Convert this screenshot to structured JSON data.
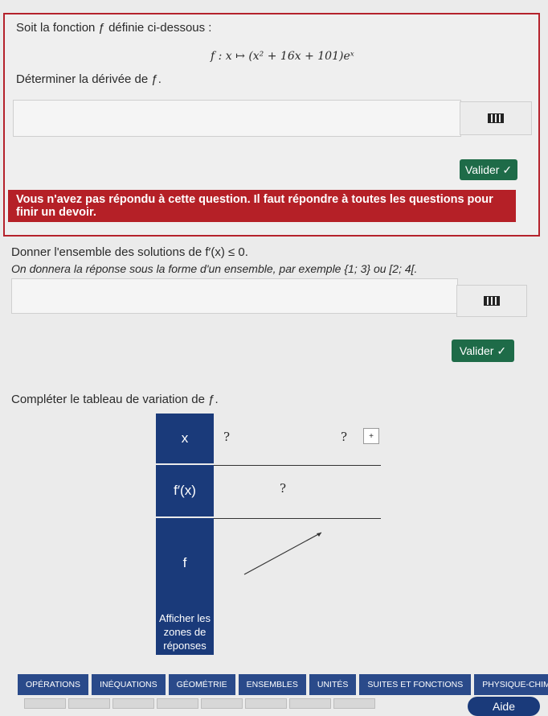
{
  "q1": {
    "intro": "Soit la fonction ƒ définie ci-dessous :",
    "formula": "f : x ↦ (x² + 16x + 101)eˣ",
    "task": "Déterminer la dérivée de ƒ.",
    "validate_label": "Valider ✓",
    "error_banner": "Vous n'avez pas répondu à cette question. Il faut répondre à toutes les questions pour finir un devoir."
  },
  "q2": {
    "task": "Donner l'ensemble des solutions de f′(x) ≤ 0.",
    "hint": "On donnera la réponse sous la forme d'un ensemble, par exemple {1; 3} ou [2; 4[.",
    "validate_label": "Valider ✓"
  },
  "q3": {
    "task": "Compléter le tableau de variation de ƒ.",
    "row_x": "x",
    "row_fprime": "f′(x)",
    "row_f": "f",
    "x_left": "?",
    "x_right": "?",
    "fprime_value": "?",
    "plus_button": "+",
    "show_answers": "Afficher les zones de réponses"
  },
  "menu": [
    "OPÉRATIONS",
    "INÉQUATIONS",
    "GÉOMÉTRIE",
    "ENSEMBLES",
    "UNITÉS",
    "SUITES ET FONCTIONS",
    "PHYSIQUE-CHIMIE"
  ],
  "help_label": "Aide",
  "colors": {
    "error_red": "#b52027",
    "validate_green": "#1e6b48",
    "table_blue": "#1a3a7a",
    "menu_blue": "#2a4a8a"
  },
  "icons": {
    "keyboard": "keyboard-icon",
    "check": "check-icon"
  }
}
